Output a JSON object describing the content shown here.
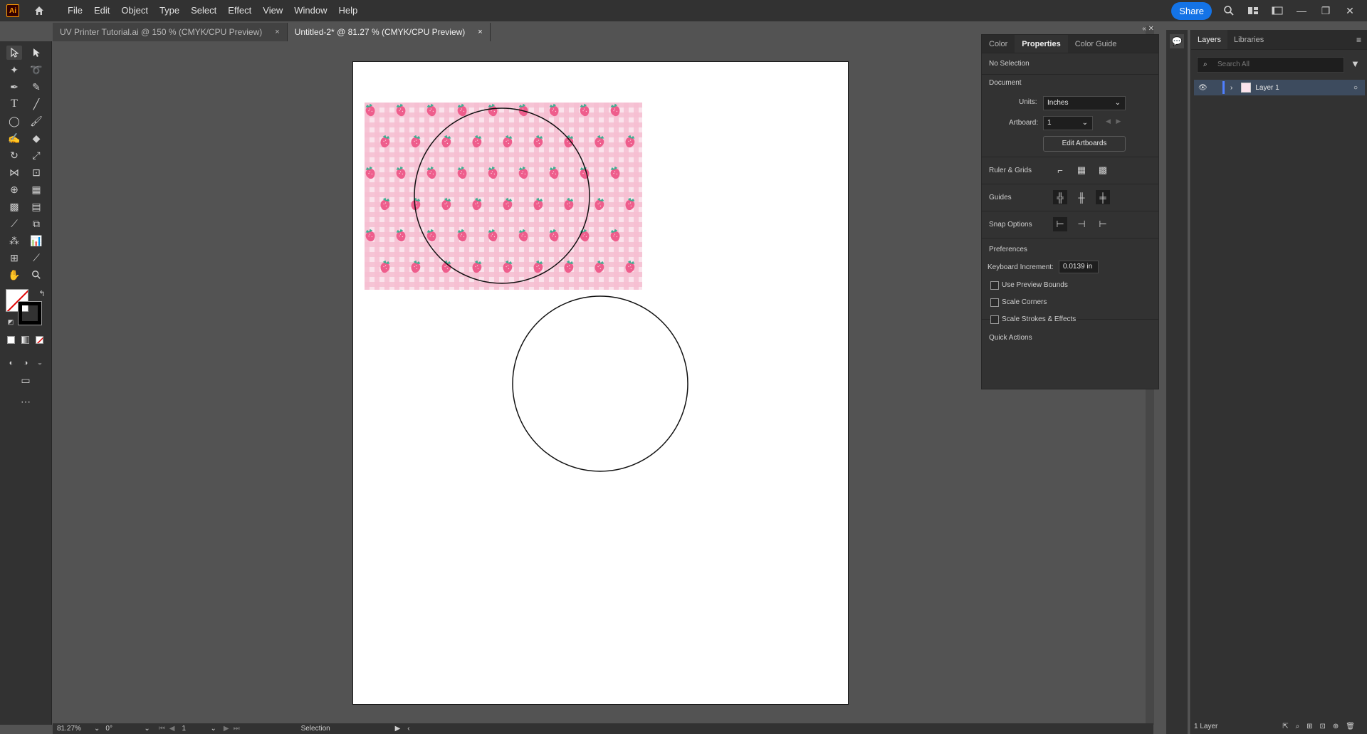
{
  "app": {
    "logo": "Ai",
    "menus": [
      "File",
      "Edit",
      "Object",
      "Type",
      "Select",
      "Effect",
      "View",
      "Window",
      "Help"
    ],
    "share_label": "Share"
  },
  "tabs": [
    {
      "label": "UV Printer Tutorial.ai @ 150 % (CMYK/CPU Preview)",
      "close": "×"
    },
    {
      "label": "Untitled-2* @ 81.27 % (CMYK/CPU Preview)",
      "close": "×"
    }
  ],
  "properties": {
    "tabs": [
      "Color",
      "Properties",
      "Color Guide"
    ],
    "selection": "No Selection",
    "document_label": "Document",
    "units_label": "Units:",
    "units_value": "Inches",
    "artboard_label": "Artboard:",
    "artboard_value": "1",
    "edit_artboards": "Edit Artboards",
    "ruler_grids": "Ruler & Grids",
    "guides": "Guides",
    "snap_options": "Snap Options",
    "preferences": "Preferences",
    "keyboard_increment_label": "Keyboard Increment:",
    "keyboard_increment_value": "0.0139 in",
    "use_preview_bounds": "Use Preview Bounds",
    "scale_corners": "Scale Corners",
    "scale_strokes": "Scale Strokes & Effects",
    "quick_actions": "Quick Actions"
  },
  "layers": {
    "tabs": [
      "Layers",
      "Libraries"
    ],
    "search_placeholder": "Search All",
    "layer_name": "Layer 1",
    "footer_count": "1 Layer"
  },
  "status": {
    "zoom": "81.27%",
    "rotation": "0°",
    "artboard_num": "1",
    "tool": "Selection"
  }
}
